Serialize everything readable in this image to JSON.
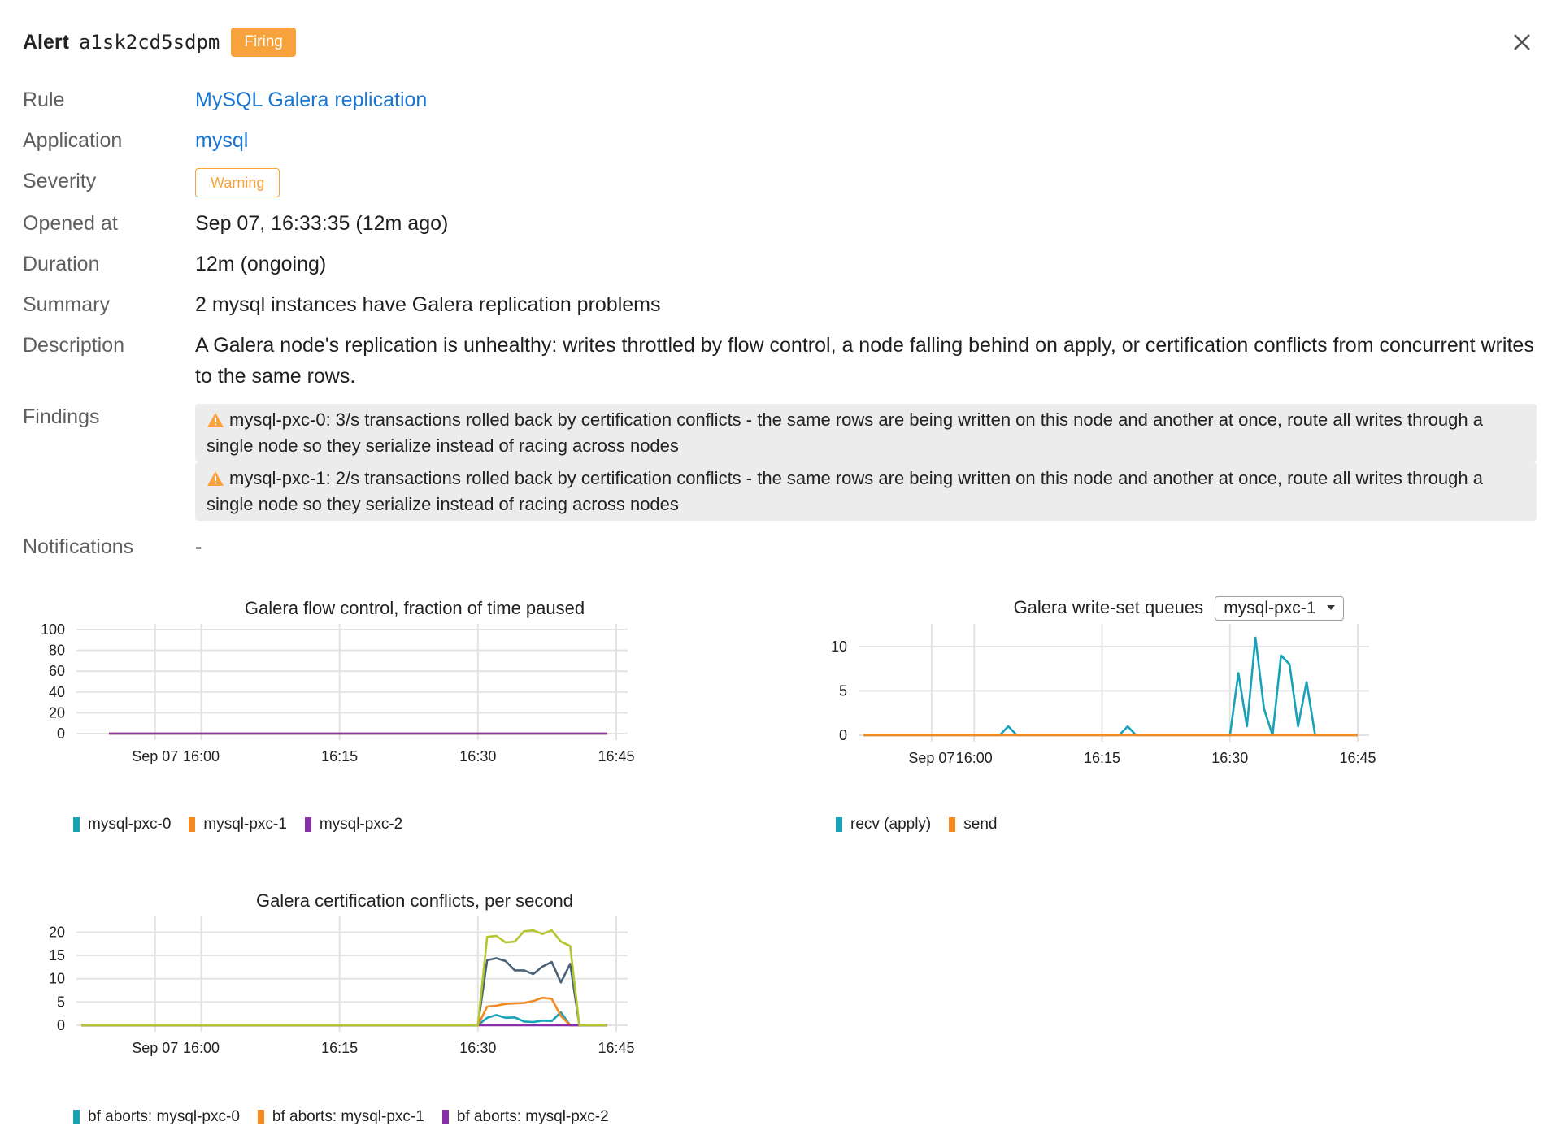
{
  "header": {
    "prefix": "Alert",
    "alert_id": "a1sk2cd5sdpm",
    "status": "Firing"
  },
  "details": {
    "rule_label": "Rule",
    "rule_value": "MySQL Galera replication",
    "application_label": "Application",
    "application_value": "mysql",
    "severity_label": "Severity",
    "severity_value": "Warning",
    "opened_label": "Opened at",
    "opened_value": "Sep 07, 16:33:35 (12m ago)",
    "duration_label": "Duration",
    "duration_value": "12m (ongoing)",
    "summary_label": "Summary",
    "summary_value": "2 mysql instances have Galera replication problems",
    "description_label": "Description",
    "description_value": "A Galera node's replication is unhealthy: writes throttled by flow control, a node falling behind on apply, or certification conflicts from concurrent writes to the same rows.",
    "findings_label": "Findings",
    "findings": [
      "mysql-pxc-0: 3/s transactions rolled back by certification conflicts - the same rows are being written on this node and another at once, route all writes through a single node so they serialize instead of racing across nodes",
      "mysql-pxc-1: 2/s transactions rolled back by certification conflicts - the same rows are being written on this node and another at once, route all writes through a single node so they serialize instead of racing across nodes"
    ],
    "notifications_label": "Notifications",
    "notifications_value": "-"
  },
  "colors": {
    "firing": "#f7a23b",
    "link": "#1976d2",
    "warning": "#f7a23b"
  },
  "icons": {
    "close": "close-icon",
    "warning": "warning-triangle-icon",
    "dropdown": "caret-down-icon"
  },
  "chart_data": [
    {
      "type": "line",
      "title": "Galera flow control, fraction of time paused",
      "x": [
        "15:50",
        "15:55",
        "16:00",
        "16:05",
        "16:10",
        "16:15",
        "16:20",
        "16:25",
        "16:30",
        "16:35",
        "16:40",
        "16:44"
      ],
      "x_range": [
        "15:47",
        "16:45"
      ],
      "xticks": [
        "Sep 07",
        "16:00",
        "16:15",
        "16:30",
        "16:45"
      ],
      "ylim": [
        0,
        100
      ],
      "yticks": [
        0,
        20,
        40,
        60,
        80,
        100
      ],
      "grid": true,
      "legend_position": "bottom-left",
      "series": [
        {
          "name": "mysql-pxc-0",
          "color": "#17a2b8",
          "values": [
            0,
            0,
            0,
            0,
            0,
            0,
            0,
            0,
            0,
            0,
            0,
            0
          ]
        },
        {
          "name": "mysql-pxc-1",
          "color": "#f5891f",
          "values": [
            0,
            0,
            0,
            0,
            0,
            0,
            0,
            0,
            0,
            0,
            0,
            0
          ]
        },
        {
          "name": "mysql-pxc-2",
          "color": "#8a2eaa",
          "values": [
            0,
            0,
            0,
            0,
            0,
            0,
            0,
            0,
            0,
            0,
            0,
            0
          ]
        }
      ]
    },
    {
      "type": "line",
      "title": "Galera write-set queues",
      "selector_value": "mysql-pxc-1",
      "x": [
        "15:47",
        "16:03",
        "16:04",
        "16:05",
        "16:17",
        "16:18",
        "16:19",
        "16:30",
        "16:31",
        "16:32",
        "16:33",
        "16:34",
        "16:35",
        "16:36",
        "16:37",
        "16:38",
        "16:39",
        "16:40",
        "16:45"
      ],
      "x_range": [
        "15:47",
        "16:45"
      ],
      "xticks": [
        "Sep 07",
        "16:00",
        "16:15",
        "16:30",
        "16:45"
      ],
      "ylim": [
        0,
        12
      ],
      "yticks": [
        0,
        5,
        10
      ],
      "grid": true,
      "legend_position": "bottom-left",
      "series": [
        {
          "name": "recv (apply)",
          "color": "#17a2b8",
          "values": [
            0,
            0,
            1,
            0,
            0,
            1,
            0,
            0,
            7,
            1,
            11,
            3,
            0,
            9,
            8,
            1,
            6,
            0,
            0
          ]
        },
        {
          "name": "send",
          "color": "#f5891f",
          "values": [
            0,
            0,
            0,
            0,
            0,
            0,
            0,
            0,
            0,
            0,
            0,
            0,
            0,
            0,
            0,
            0,
            0,
            0,
            0
          ]
        }
      ]
    },
    {
      "type": "line",
      "title": "Galera certification conflicts, per second",
      "x": [
        "15:47",
        "16:30",
        "16:31",
        "16:32",
        "16:33",
        "16:34",
        "16:35",
        "16:36",
        "16:37",
        "16:38",
        "16:39",
        "16:40",
        "16:41",
        "16:42",
        "16:43",
        "16:44"
      ],
      "x_range": [
        "15:47",
        "16:45"
      ],
      "xticks": [
        "Sep 07",
        "16:00",
        "16:15",
        "16:30",
        "16:45"
      ],
      "ylim": [
        0,
        22
      ],
      "yticks": [
        0,
        5,
        10,
        15,
        20
      ],
      "grid": true,
      "legend_position": "bottom-left",
      "series": [
        {
          "name": "bf aborts: mysql-pxc-0",
          "color": "#17a2b8",
          "values": [
            0,
            0,
            1.6,
            2.2,
            1.6,
            1.7,
            0.8,
            0.7,
            1.0,
            0.9,
            2.8,
            0,
            0,
            0,
            0,
            0
          ]
        },
        {
          "name": "bf aborts: mysql-pxc-1",
          "color": "#f5891f",
          "values": [
            0,
            0,
            4.0,
            4.2,
            4.6,
            4.7,
            4.8,
            5.2,
            5.9,
            5.7,
            2.0,
            0,
            0,
            0,
            0,
            0
          ]
        },
        {
          "name": "bf aborts: mysql-pxc-2",
          "color": "#8a2eaa",
          "values": [
            0,
            0,
            0,
            0,
            0,
            0,
            0,
            0,
            0,
            0,
            0,
            0,
            0,
            0,
            0,
            0
          ]
        },
        {
          "color": "#4a6277",
          "values": [
            0,
            0,
            14.0,
            14.4,
            13.8,
            11.8,
            11.8,
            11.0,
            12.6,
            13.6,
            9.2,
            13.2,
            0,
            0,
            0,
            0
          ]
        },
        {
          "color": "#b5c52d",
          "values": [
            0,
            0,
            19.0,
            19.2,
            17.8,
            18.0,
            20.2,
            20.4,
            19.6,
            20.4,
            18.0,
            17.0,
            0,
            0,
            0,
            0
          ]
        }
      ]
    }
  ]
}
